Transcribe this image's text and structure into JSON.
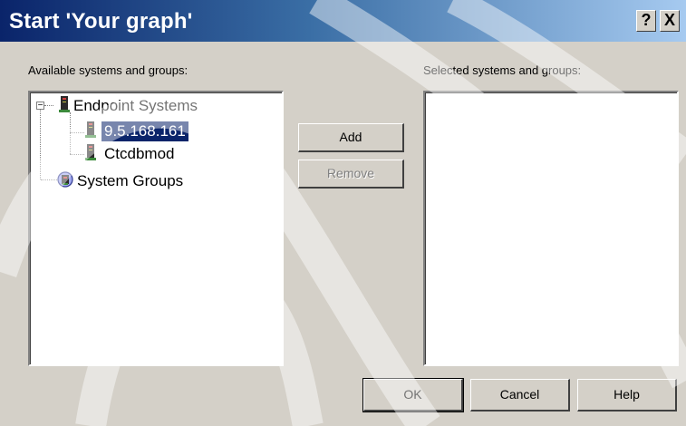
{
  "dialog": {
    "title": "Start 'Your graph'",
    "help_button": "?",
    "close_button": "X"
  },
  "available": {
    "label": "Available systems and groups:",
    "tree": {
      "root": "Endpoint Systems",
      "children": [
        "9.5.168.161",
        "Ctcdbmod"
      ],
      "groups": "System Groups"
    },
    "selected_item": "9.5.168.161"
  },
  "selected": {
    "label": "Selected systems and groups:"
  },
  "buttons": {
    "add": "Add",
    "remove": "Remove",
    "ok": "OK",
    "cancel": "Cancel",
    "help": "Help"
  },
  "colors": {
    "titlebar_start": "#0a246a",
    "titlebar_end": "#a6caf0",
    "selection": "#0a246a",
    "dialog_bg": "#d4d0c8"
  },
  "icons": {
    "system": "computer-tower-icon",
    "groups": "system-groups-icon"
  }
}
